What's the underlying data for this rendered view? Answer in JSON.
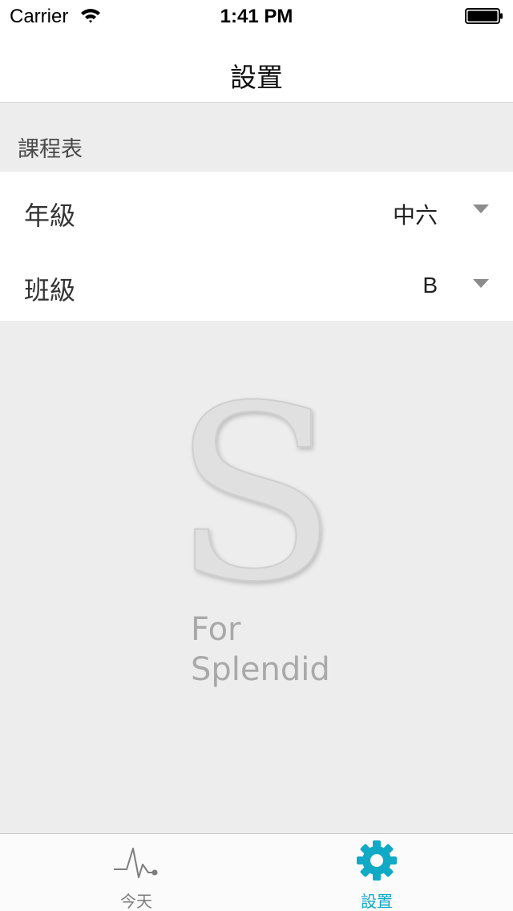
{
  "status_bar": {
    "carrier": "Carrier",
    "time": "1:41 PM"
  },
  "nav": {
    "title": "設置"
  },
  "section": {
    "header": "課程表"
  },
  "settings": {
    "grade": {
      "label": "年級",
      "value": "中六"
    },
    "class": {
      "label": "班級",
      "value": "B"
    }
  },
  "logo": {
    "letter": "S",
    "line1": "For",
    "line2": "Splendid"
  },
  "tab_bar": {
    "today": {
      "label": "今天",
      "icon": "pulse-icon"
    },
    "settings": {
      "label": "設置",
      "icon": "gear-icon"
    }
  },
  "colors": {
    "accent": "#10aac6",
    "inactive": "#7d7d7d",
    "background": "#ededed"
  }
}
